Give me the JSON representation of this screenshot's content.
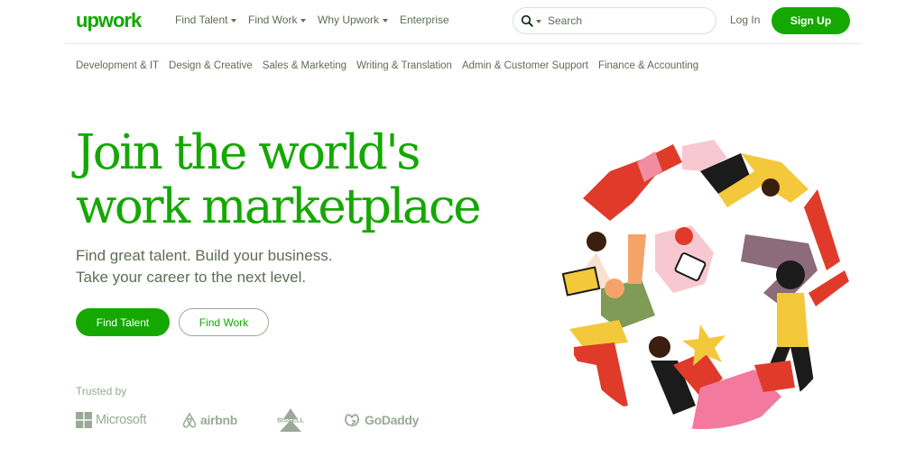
{
  "header": {
    "logo_text": "upwork",
    "nav": [
      {
        "label": "Find Talent",
        "has_caret": true
      },
      {
        "label": "Find Work",
        "has_caret": true
      },
      {
        "label": "Why Upwork",
        "has_caret": true
      },
      {
        "label": "Enterprise",
        "has_caret": false
      }
    ],
    "search": {
      "placeholder": "Search",
      "icon": "search-icon"
    },
    "login_label": "Log In",
    "signup_label": "Sign Up"
  },
  "categories": [
    "Development & IT",
    "Design & Creative",
    "Sales & Marketing",
    "Writing & Translation",
    "Admin & Customer Support",
    "Finance & Accounting"
  ],
  "hero": {
    "title_line1": "Join the world's",
    "title_line2": "work marketplace",
    "subtitle_line1": "Find great talent. Build your business.",
    "subtitle_line2": "Take your career to the next level.",
    "primary_cta": "Find Talent",
    "secondary_cta": "Find Work"
  },
  "trusted": {
    "label": "Trusted by",
    "brands": [
      "Microsoft",
      "airbnb",
      "BISSELL",
      "GoDaddy"
    ]
  },
  "colors": {
    "brand_green": "#14a800",
    "text_muted": "#5e6d55",
    "logo_gray": "#9aaa97"
  }
}
